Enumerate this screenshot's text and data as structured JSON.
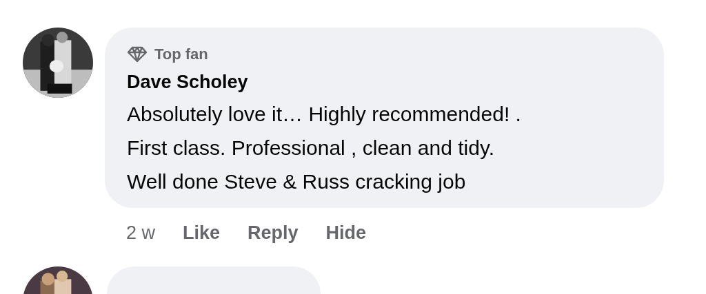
{
  "comments": [
    {
      "badge": "Top fan",
      "author": "Dave Scholey",
      "text": "Absolutely love it… Highly recommended! . First class. Professional , clean and tidy. Well done Steve & Russ cracking job",
      "time": "2 w",
      "actions": [
        "Like",
        "Reply",
        "Hide"
      ]
    },
    {
      "kind": "picture"
    }
  ]
}
